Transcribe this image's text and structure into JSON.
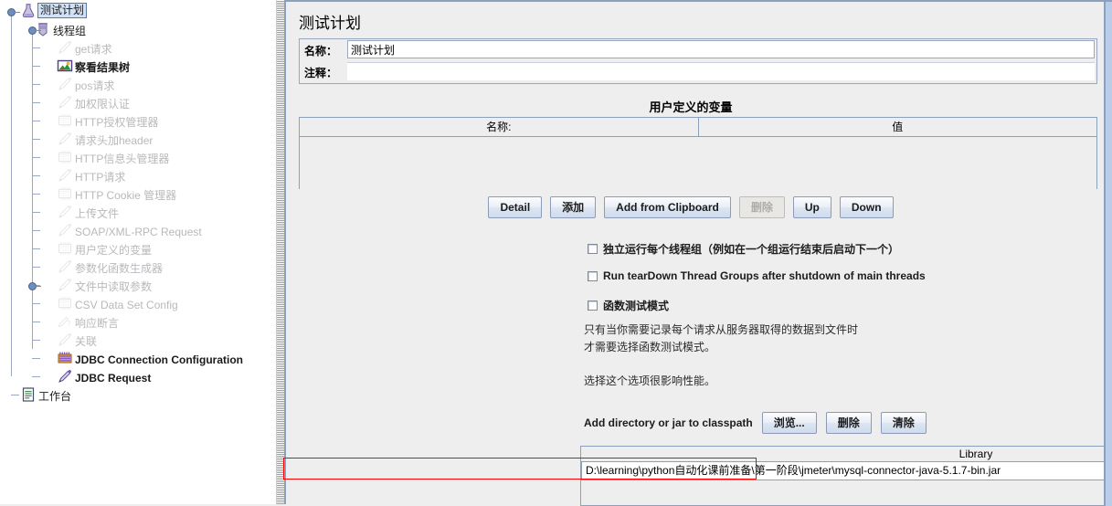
{
  "tree": {
    "items": [
      {
        "label": "测试计划",
        "icon": "flask-icon",
        "state": "selected",
        "depth": 0
      },
      {
        "label": "线程组",
        "icon": "thread-group-icon",
        "state": "enabled",
        "depth": 1
      },
      {
        "label": "get请求",
        "icon": "sampler-icon",
        "state": "disabled",
        "depth": 2
      },
      {
        "label": "察看结果树",
        "icon": "view-results-tree-icon",
        "state": "enabled",
        "depth": 2
      },
      {
        "label": "pos请求",
        "icon": "sampler-icon",
        "state": "disabled",
        "depth": 2
      },
      {
        "label": "加权限认证",
        "icon": "sampler-icon",
        "state": "disabled",
        "depth": 2
      },
      {
        "label": "HTTP授权管理器",
        "icon": "config-element-icon",
        "state": "disabled",
        "depth": 2
      },
      {
        "label": "请求头加header",
        "icon": "sampler-icon",
        "state": "disabled",
        "depth": 2
      },
      {
        "label": "HTTP信息头管理器",
        "icon": "config-element-icon",
        "state": "disabled",
        "depth": 2
      },
      {
        "label": "HTTP请求",
        "icon": "sampler-icon",
        "state": "disabled",
        "depth": 2
      },
      {
        "label": "HTTP Cookie 管理器",
        "icon": "config-element-icon",
        "state": "disabled",
        "depth": 2
      },
      {
        "label": "上传文件",
        "icon": "sampler-icon",
        "state": "disabled",
        "depth": 2
      },
      {
        "label": "SOAP/XML-RPC Request",
        "icon": "sampler-icon",
        "state": "disabled",
        "depth": 2
      },
      {
        "label": "用户定义的变量",
        "icon": "config-element-icon",
        "state": "disabled",
        "depth": 2
      },
      {
        "label": "参数化函数生成器",
        "icon": "sampler-icon",
        "state": "disabled",
        "depth": 2
      },
      {
        "label": "文件中读取参数",
        "icon": "sampler-icon",
        "state": "disabled",
        "depth": 2
      },
      {
        "label": "CSV Data Set Config",
        "icon": "config-element-icon",
        "state": "disabled",
        "depth": 2
      },
      {
        "label": "响应断言",
        "icon": "assertion-icon",
        "state": "disabled",
        "depth": 2
      },
      {
        "label": "关联",
        "icon": "sampler-icon",
        "state": "disabled",
        "depth": 2
      },
      {
        "label": "JDBC Connection Configuration",
        "icon": "jdbc-config-icon",
        "state": "enabled",
        "depth": 2
      },
      {
        "label": "JDBC Request",
        "icon": "jdbc-request-icon",
        "state": "enabled",
        "depth": 2
      },
      {
        "label": "工作台",
        "icon": "workbench-icon",
        "state": "enabled",
        "depth": 0
      }
    ]
  },
  "panel": {
    "title": "测试计划",
    "name_label": "名称：",
    "name_value": "测试计划",
    "comment_label": "注释：",
    "comment_value": "",
    "udv_title": "用户定义的变量",
    "var_table": {
      "columns": [
        "名称:",
        "值"
      ],
      "rows": []
    },
    "buttons": [
      {
        "label": "Detail",
        "enabled": true,
        "name": "detail-button"
      },
      {
        "label": "添加",
        "enabled": true,
        "name": "add-button"
      },
      {
        "label": "Add from Clipboard",
        "enabled": true,
        "name": "add-from-clipboard-button"
      },
      {
        "label": "删除",
        "enabled": false,
        "name": "delete-button"
      },
      {
        "label": "Up",
        "enabled": true,
        "name": "up-button"
      },
      {
        "label": "Down",
        "enabled": true,
        "name": "down-button"
      }
    ],
    "checkboxes": [
      {
        "label": "独立运行每个线程组（例如在一个组运行结束后启动下一个）",
        "checked": false,
        "name": "run-thread-groups-consecutively-checkbox"
      },
      {
        "label": "Run tearDown Thread Groups after shutdown of main threads",
        "checked": false,
        "name": "run-teardown-checkbox"
      },
      {
        "label": "函数测试模式",
        "checked": false,
        "name": "functional-test-mode-checkbox"
      }
    ],
    "notes": [
      "只有当你需要记录每个请求从服务器取得的数据到文件时",
      "才需要选择函数测试模式。",
      "选择这个选项很影响性能。"
    ],
    "classpath_label": "Add directory or jar to classpath",
    "classpath_buttons": [
      {
        "label": "浏览...",
        "name": "browse-button"
      },
      {
        "label": "删除",
        "name": "classpath-delete-button"
      },
      {
        "label": "清除",
        "name": "classpath-clear-button"
      }
    ],
    "library_header": "Library",
    "library_rows": [
      "D:\\learning\\python自动化课前准备\\第一阶段\\jmeter\\mysql-connector-java-5.1.7-bin.jar"
    ]
  },
  "colors": {
    "panel_bg": "#eeeeee",
    "tree_bg": "#ffffff",
    "selection": "#d2e2f6",
    "border": "#8ba0bd",
    "annotation": "#ff0000",
    "disabled_text": "#b9b9bc"
  }
}
